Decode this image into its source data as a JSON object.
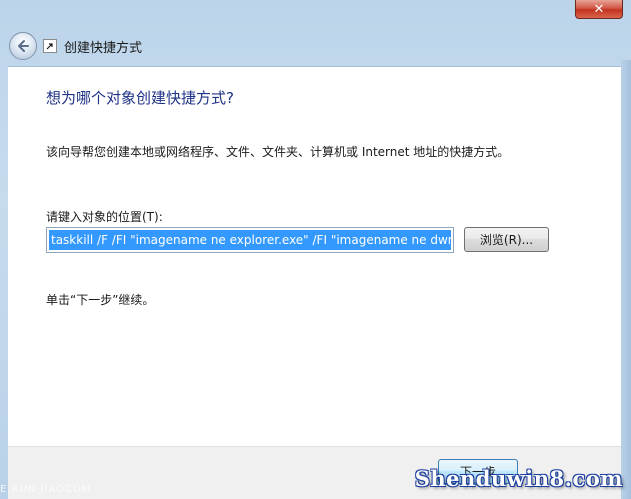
{
  "window": {
    "title": "创建快捷方式",
    "close_symbol": "✕"
  },
  "nav": {
    "back_symbol": "←"
  },
  "content": {
    "heading": "想为哪个对象创建快捷方式?",
    "description": "该向导帮您创建本地或网络程序、文件、文件夹、计算机或 Internet 地址的快捷方式。",
    "field_label": "请键入对象的位置(T):",
    "location_value": "taskkill /F /FI \"imagename ne explorer.exe\" /FI \"imagename ne dwm.exe\"",
    "browse_label": "浏览(R)...",
    "hint": "单击“下一步”继续。"
  },
  "footer": {
    "next_label": "下一步"
  },
  "watermark": {
    "text": "Shenduwin8.com",
    "left_text": "E RUN JIAOCOM"
  },
  "colors": {
    "heading": "#1e3287",
    "selection": "#3399ff",
    "glass": "#bcd4ea"
  }
}
